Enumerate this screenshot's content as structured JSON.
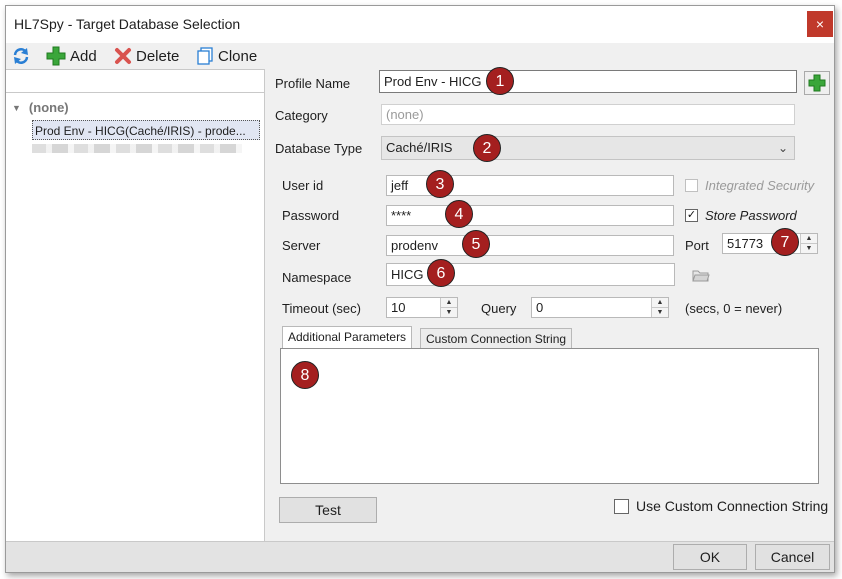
{
  "window": {
    "title": "HL7Spy - Target Database Selection",
    "close_glyph": "×"
  },
  "toolbar": {
    "add_label": "Add",
    "delete_label": "Delete",
    "clone_label": "Clone"
  },
  "tree": {
    "root_label": "(none)",
    "selected_item": "Prod Env - HICG(Caché/IRIS) - prode..."
  },
  "form": {
    "profile_name_label": "Profile Name",
    "profile_name_value": "Prod Env - HICG",
    "category_label": "Category",
    "category_placeholder": "(none)",
    "database_type_label": "Database Type",
    "database_type_value": "Caché/IRIS",
    "user_id_label": "User id",
    "user_id_value": "jeff",
    "password_label": "Password",
    "password_value": "****",
    "server_label": "Server",
    "server_value": "prodenv",
    "namespace_label": "Namespace",
    "namespace_value": "HICG",
    "port_label": "Port",
    "port_value": "51773",
    "timeout_label": "Timeout (sec)",
    "timeout_value": "10",
    "query_label": "Query",
    "query_value": "0",
    "secs_note": "(secs, 0 = never)",
    "integrated_security_label": "Integrated Security",
    "integrated_security_checked": false,
    "store_password_label": "Store Password",
    "store_password_checked": true,
    "check_glyph": "✓"
  },
  "tabs": {
    "additional_parameters": "Additional Parameters",
    "custom_connection_string": "Custom Connection String"
  },
  "use_custom_connection_label": "Use Custom Connection String",
  "buttons": {
    "test": "Test",
    "ok": "OK",
    "cancel": "Cancel"
  },
  "callouts": [
    "1",
    "2",
    "3",
    "4",
    "5",
    "6",
    "7",
    "8"
  ],
  "colors": {
    "callout": "#a41f1f",
    "add_green": "#3aa63a",
    "delete_red": "#d9534f",
    "refresh_blue": "#2a7fd4",
    "close_red": "#c0392b"
  }
}
